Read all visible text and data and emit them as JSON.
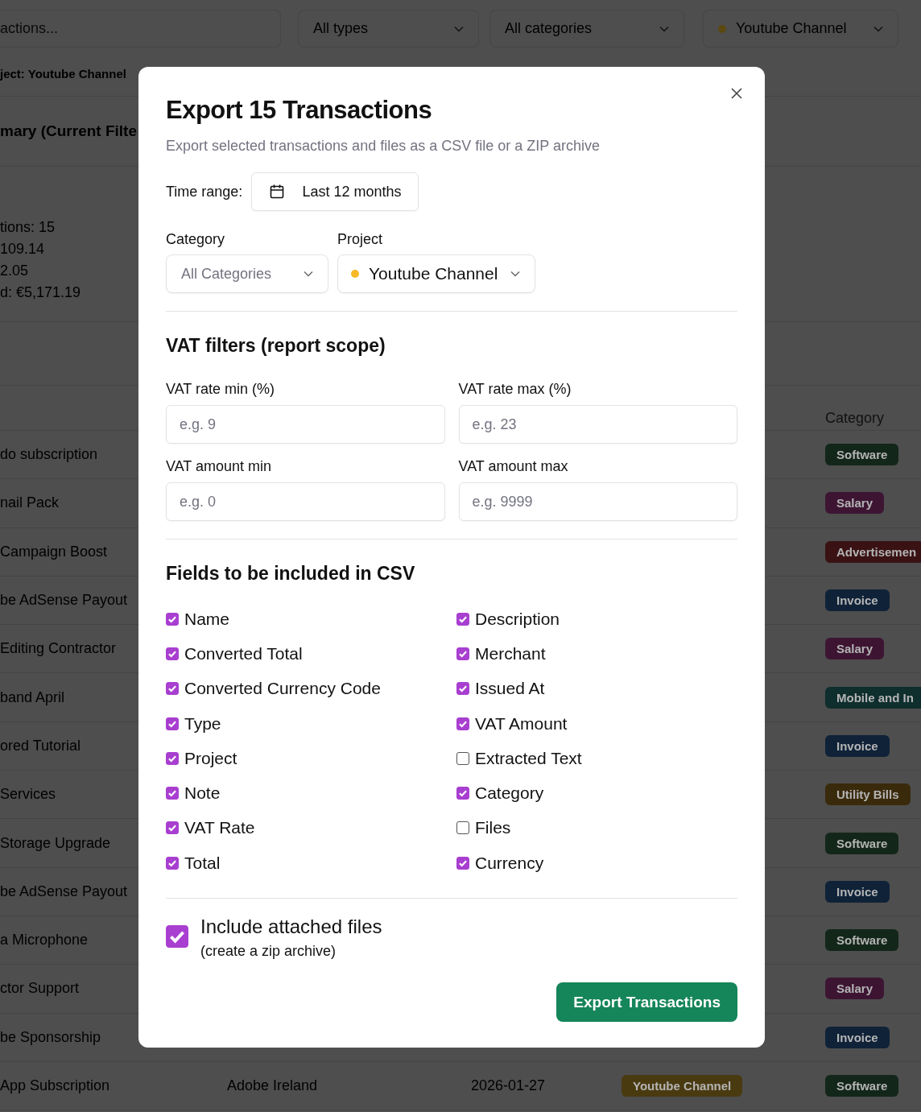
{
  "filters": {
    "search": {
      "placeholder": "actions..."
    },
    "type_select": "All types",
    "category_select": "All categories",
    "project_select": "Youtube Channel"
  },
  "active_filter_chip": "ject: Youtube Channel",
  "summary": {
    "title": "mary (Current Filte",
    "lines": [
      "tions: 15",
      "109.14",
      "2.05",
      "d: €5,171.19"
    ]
  },
  "table": {
    "category_header": "Category",
    "rows": [
      {
        "name": "do subscription",
        "category": {
          "label": "Software",
          "color": "#13261a"
        }
      },
      {
        "name": "nail Pack",
        "category": {
          "label": "Salary",
          "color": "#3d1533"
        }
      },
      {
        "name": " Campaign Boost",
        "category": {
          "label": "Advertisemen",
          "color": "#3a1214"
        }
      },
      {
        "name": "be AdSense Payout",
        "category": {
          "label": "Invoice",
          "color": "#0f2238"
        }
      },
      {
        "name": "Editing Contractor",
        "category": {
          "label": "Salary",
          "color": "#3d1533"
        }
      },
      {
        "name": "band April",
        "category": {
          "label": "Mobile and In",
          "color": "#0f2e2e"
        }
      },
      {
        "name": "ored Tutorial",
        "category": {
          "label": "Invoice",
          "color": "#0f2238"
        }
      },
      {
        "name": " Services",
        "category": {
          "label": "Utility Bills",
          "color": "#3a2a0c"
        }
      },
      {
        "name": "Storage Upgrade",
        "category": {
          "label": "Software",
          "color": "#13261a"
        }
      },
      {
        "name": "be AdSense Payout",
        "category": {
          "label": "Invoice",
          "color": "#0f2238"
        }
      },
      {
        "name": "a Microphone",
        "category": {
          "label": "Software",
          "color": "#13261a"
        }
      },
      {
        "name": "ctor Support",
        "category": {
          "label": "Salary",
          "color": "#3d1533"
        }
      },
      {
        "name": "be Sponsorship",
        "category": {
          "label": "Invoice",
          "color": "#0f2238"
        }
      },
      {
        "name": " App Subscription",
        "merchant": "Adobe Ireland",
        "date": "2026-01-27",
        "project": {
          "label": "Youtube Channel",
          "color": "#4a3a10"
        },
        "category": {
          "label": "Software",
          "color": "#13261a"
        }
      }
    ]
  },
  "modal": {
    "title": "Export 15 Transactions",
    "subtitle": "Export selected transactions and files as a CSV file or a ZIP archive",
    "time_range": {
      "label": "Time range:",
      "value": "Last 12 months"
    },
    "category": {
      "label": "Category",
      "placeholder": "All Categories"
    },
    "project": {
      "label": "Project",
      "value": "Youtube Channel"
    },
    "vat_section": {
      "title": "VAT filters (report scope)",
      "fields": [
        {
          "label": "VAT rate min (%)",
          "placeholder": "e.g. 9"
        },
        {
          "label": "VAT rate max (%)",
          "placeholder": "e.g. 23"
        },
        {
          "label": "VAT amount min",
          "placeholder": "e.g. 0"
        },
        {
          "label": "VAT amount max",
          "placeholder": "e.g. 9999"
        }
      ]
    },
    "csv_section": {
      "title": "Fields to be included in CSV",
      "fields": [
        {
          "label": "Name",
          "checked": true
        },
        {
          "label": "Description",
          "checked": true
        },
        {
          "label": "Converted Total",
          "checked": true
        },
        {
          "label": "Merchant",
          "checked": true
        },
        {
          "label": "Converted Currency Code",
          "checked": true
        },
        {
          "label": "Issued At",
          "checked": true
        },
        {
          "label": "Type",
          "checked": true
        },
        {
          "label": "VAT Amount",
          "checked": true
        },
        {
          "label": "Project",
          "checked": true
        },
        {
          "label": "Extracted Text",
          "checked": false
        },
        {
          "label": "Note",
          "checked": true
        },
        {
          "label": "Category",
          "checked": true
        },
        {
          "label": "VAT Rate",
          "checked": true
        },
        {
          "label": "Files",
          "checked": false
        },
        {
          "label": "Total",
          "checked": true
        },
        {
          "label": "Currency",
          "checked": true
        }
      ]
    },
    "include_files": {
      "checked": true,
      "label": "Include attached files",
      "hint": "(create a zip archive)"
    },
    "export_button": "Export Transactions"
  }
}
